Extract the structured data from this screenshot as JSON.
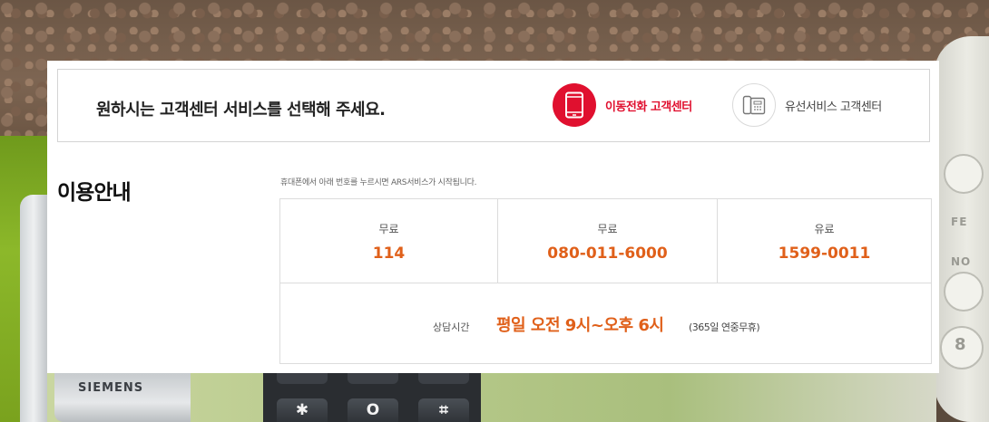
{
  "background": {
    "brand_text": "SIEMENS",
    "dial_labels": [
      "FE",
      "NO"
    ],
    "dial_digit": "8",
    "keypad_keys": [
      "✱",
      "O",
      "⌗"
    ]
  },
  "selector": {
    "title": "원하시는 고객센터 서비스를 선택해 주세요.",
    "options": [
      {
        "label": "이동전화 고객센터",
        "icon": "mobile-phone-icon",
        "active": true,
        "color": "#e0102f"
      },
      {
        "label": "유선서비스 고객센터",
        "icon": "landline-phone-icon",
        "active": false
      }
    ]
  },
  "guide": {
    "title": "이용안내",
    "note": "휴대폰에서 아래 번호를 누르시면 ARS서비스가 시작됩니다.",
    "numbers": [
      {
        "type": "무료",
        "number": "114"
      },
      {
        "type": "무료",
        "number": "080-011-6000"
      },
      {
        "type": "유료",
        "number": "1599-0011"
      }
    ],
    "hours_label": "상담시간",
    "hours_value": "평일 오전 9시~오후 6시",
    "hours_note": "(365일 연중무휴)",
    "accent_color": "#e0601a"
  }
}
